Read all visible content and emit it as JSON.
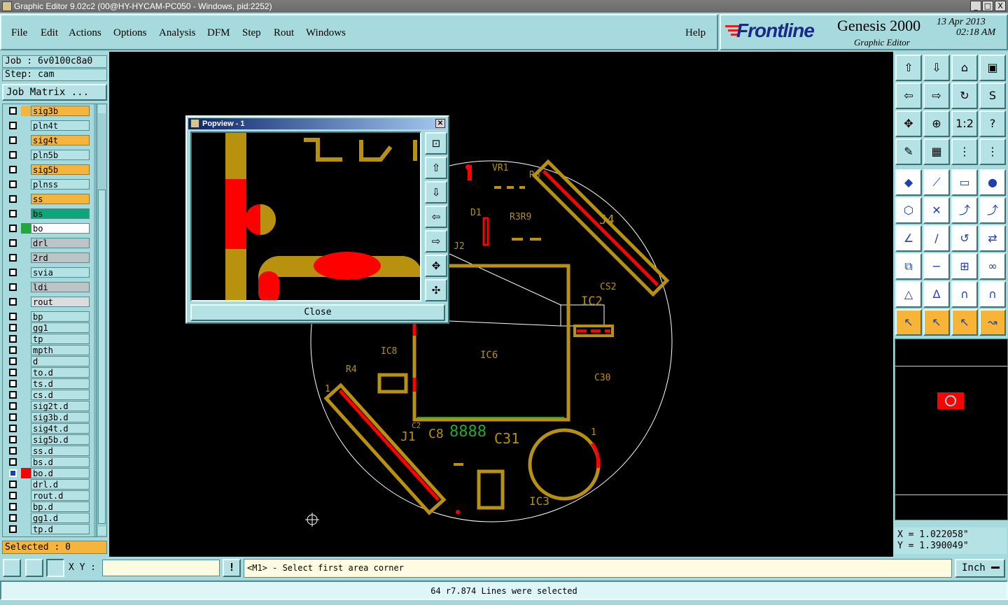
{
  "window": {
    "title": "Graphic Editor 9.02c2 (00@HY-HYCAM-PC050 - Windows, pid:2252)",
    "controls": [
      "_",
      "□",
      "X"
    ]
  },
  "menu": {
    "items": [
      "File",
      "Edit",
      "Actions",
      "Options",
      "Analysis",
      "DFM",
      "Step",
      "Rout",
      "Windows"
    ],
    "help": "Help"
  },
  "brand": {
    "logo": "Frontline",
    "product": "Genesis 2000",
    "subtitle": "Graphic Editor",
    "date": "13 Apr 2013",
    "time": "02:18 AM"
  },
  "job": {
    "job_label": "Job : 6v0100c8a0",
    "step_label": "Step: cam",
    "matrix_button": "Job Matrix ...",
    "selected": "Selected : 0"
  },
  "layers": [
    {
      "name": "sig3b",
      "color": "#f5b43c",
      "bg": "#f5b43c"
    },
    {
      "name": "pln4t",
      "color": "",
      "bg": "#b4e2e5"
    },
    {
      "name": "sig4t",
      "color": "",
      "bg": "#f5b43c"
    },
    {
      "name": "pln5b",
      "color": "",
      "bg": "#b4e2e5"
    },
    {
      "name": "sig5b",
      "color": "",
      "bg": "#f5b43c"
    },
    {
      "name": "plnss",
      "color": "",
      "bg": "#b4e2e5"
    },
    {
      "name": "ss",
      "color": "",
      "bg": "#f5b43c"
    },
    {
      "name": "bs",
      "color": "",
      "bg": "#0ea57a"
    },
    {
      "name": "bo",
      "color": "#22a83a",
      "bg": "#ffffff"
    },
    {
      "name": "drl",
      "color": "",
      "bg": "#bcc4c6"
    },
    {
      "name": "2rd",
      "color": "",
      "bg": "#bcc4c6"
    },
    {
      "name": "svia",
      "color": "",
      "bg": "#b4e2e5"
    },
    {
      "name": "ldi",
      "color": "",
      "bg": "#bcc4c6"
    },
    {
      "name": "rout",
      "color": "",
      "bg": "#dcdcdc"
    },
    {
      "name": "bp",
      "color": "",
      "bg": "#b4e2e5"
    },
    {
      "name": "gg1",
      "color": "",
      "bg": "#b4e2e5"
    },
    {
      "name": "tp",
      "color": "",
      "bg": "#b4e2e5"
    },
    {
      "name": "mpth",
      "color": "",
      "bg": "#b4e2e5"
    },
    {
      "name": "d",
      "color": "",
      "bg": "#b4e2e5"
    },
    {
      "name": "to.d",
      "color": "",
      "bg": "#b4e2e5"
    },
    {
      "name": "ts.d",
      "color": "",
      "bg": "#b4e2e5"
    },
    {
      "name": "cs.d",
      "color": "",
      "bg": "#b4e2e5"
    },
    {
      "name": "sig2t.d",
      "color": "",
      "bg": "#b4e2e5"
    },
    {
      "name": "sig3b.d",
      "color": "",
      "bg": "#b4e2e5"
    },
    {
      "name": "sig4t.d",
      "color": "",
      "bg": "#b4e2e5"
    },
    {
      "name": "sig5b.d",
      "color": "",
      "bg": "#b4e2e5"
    },
    {
      "name": "ss.d",
      "color": "",
      "bg": "#b4e2e5"
    },
    {
      "name": "bs.d",
      "color": "",
      "bg": "#b4e2e5"
    },
    {
      "name": "bo.d",
      "color": "#ff0000",
      "bg": "#b4e2e5"
    },
    {
      "name": "drl.d",
      "color": "",
      "bg": "#b4e2e5"
    },
    {
      "name": "rout.d",
      "color": "",
      "bg": "#b4e2e5"
    },
    {
      "name": "bp.d",
      "color": "",
      "bg": "#b4e2e5"
    },
    {
      "name": "gg1.d",
      "color": "",
      "bg": "#b4e2e5"
    },
    {
      "name": "tp.d",
      "color": "",
      "bg": "#b4e2e5"
    }
  ],
  "popview": {
    "title": "Popview - 1",
    "close_label": "Close"
  },
  "board_labels": {
    "vr1": "VR1",
    "r6": "R6",
    "d1": "D1",
    "r3r9": "R3R9",
    "j4": "J4",
    "j2": "J2",
    "cs2": "CS2",
    "ic2": "IC2",
    "ic8": "IC8",
    "ic6": "IC6",
    "c30": "C30",
    "r4": "R4",
    "one_a": "1",
    "j1": "J1",
    "c2": "C2",
    "c8": "C8",
    "c8888": "8888",
    "c31": "C31",
    "one_b": "1",
    "ic3": "IC3"
  },
  "coords": {
    "x": "X = 1.022058\"",
    "y": "Y = 1.390049\""
  },
  "command": {
    "xy_label": "X Y :",
    "xy_value": "",
    "prompt": "<M1> - Select first area corner",
    "unit": "Inch"
  },
  "status": "64 r7.874 Lines were selected",
  "colors": {
    "panel": "#a6dadd",
    "copper": "#b8920f",
    "selected": "#ff0000",
    "silk": "#c8d0c8"
  }
}
